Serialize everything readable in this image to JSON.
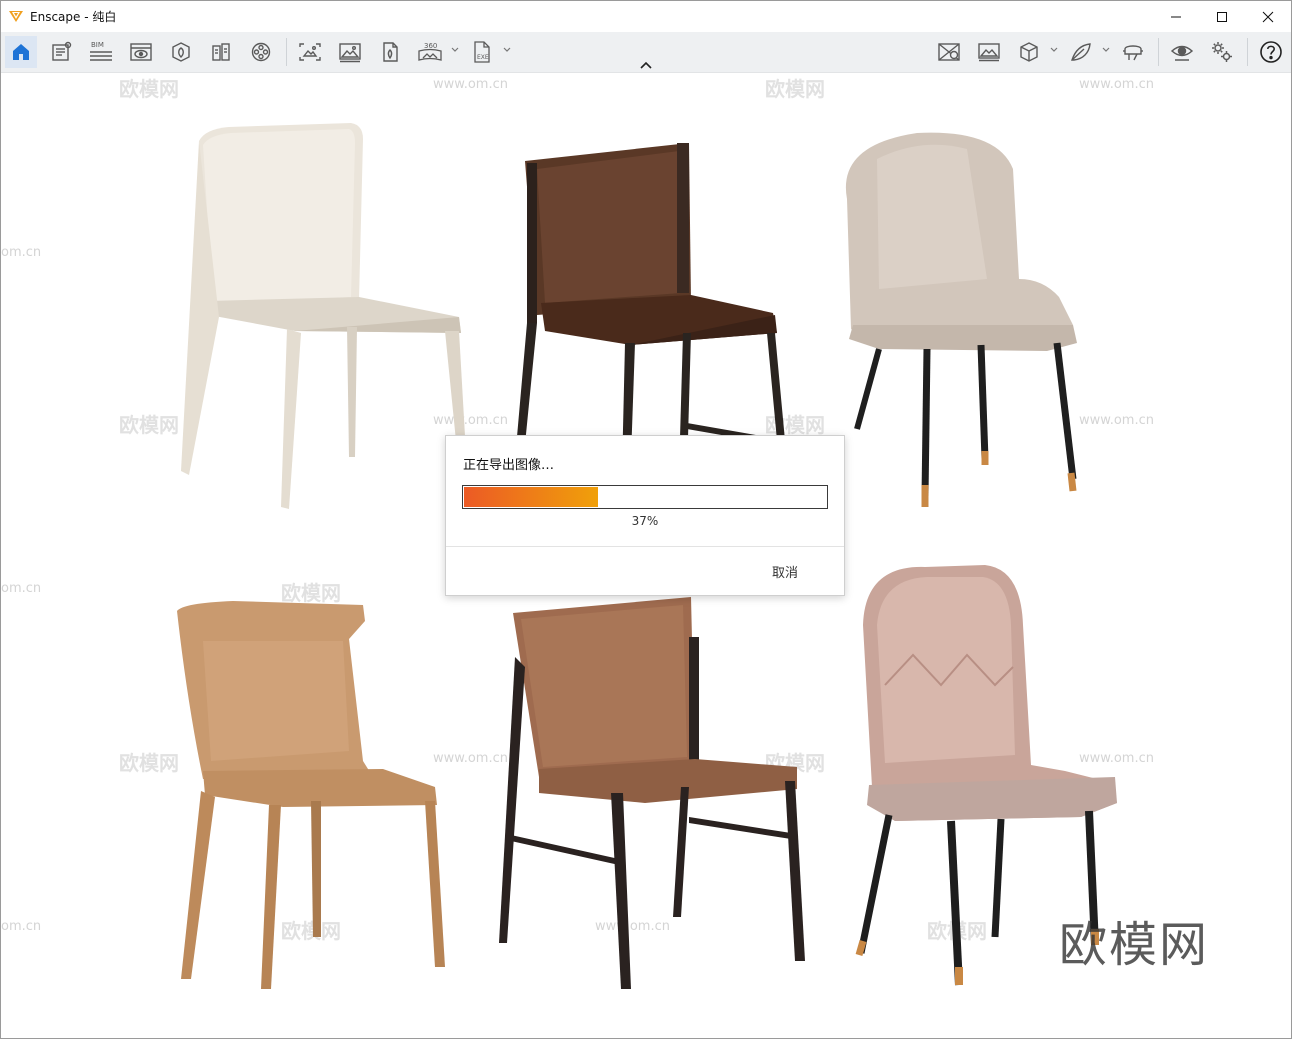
{
  "window": {
    "title": "Enscape - 纯白",
    "controls": [
      "minimize-icon",
      "maximize-icon",
      "close-icon"
    ]
  },
  "toolbar": {
    "left_icons": [
      "home-icon",
      "notes-icon",
      "bim-icon",
      "visual-settings-icon",
      "asset-library-icon",
      "material-editor-icon",
      "video-editor-icon",
      "screenshot-icon",
      "render-image-icon",
      "export-icon",
      "panorama-360-icon",
      "exe-standalone-icon"
    ],
    "labels": {
      "bim": "BIM",
      "pano": "360",
      "exe": "EXE"
    },
    "right_icons": [
      "view-management-icon",
      "batch-render-icon",
      "cube-view-icon",
      "feather-icon",
      "vr-headset-icon",
      "eye-icon",
      "settings-icon",
      "help-icon"
    ]
  },
  "dialog": {
    "title": "正在导出图像…",
    "progress": 0.37,
    "percent_label": "37%",
    "cancel_label": "取消",
    "fill_colors": [
      "#ec5a25",
      "#f0a00a"
    ]
  },
  "watermark": {
    "brand": "欧模网",
    "url": "www.om.cn",
    "fragment": "om.cn"
  },
  "colors": {
    "accent": "#1e73d6",
    "logo": "#f0a020"
  }
}
